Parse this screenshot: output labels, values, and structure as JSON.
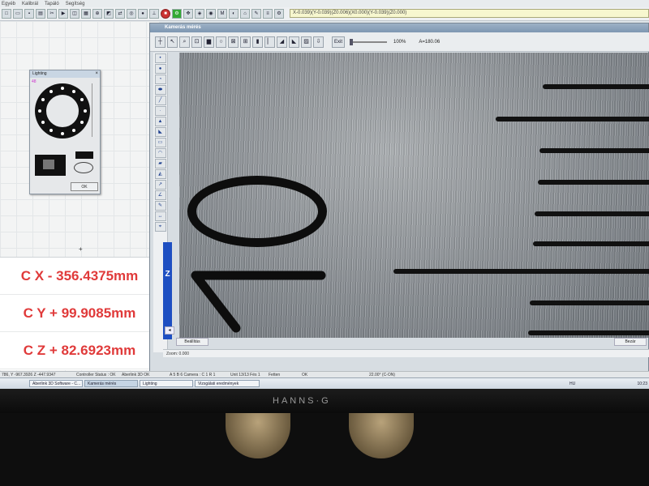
{
  "menu": [
    "Egyéb",
    "Kalibrál",
    "Tapáló",
    "Segítség"
  ],
  "coord_readout": "X-0.039)(Y-0.039)(Z0.006)(X0.000)(Y-0.039)(Z0.000)",
  "lighting": {
    "title": "Lighting",
    "ring_num": "48",
    "ok": "OK",
    "left_num": "1",
    "right_num": "0"
  },
  "dro": {
    "x": "C X - 356.4375mm",
    "y": "C Y + 99.9085mm",
    "z": "C Z + 82.6923mm"
  },
  "camera": {
    "title": "Kamerás mérés",
    "exit": "Exit",
    "zoom_pct": "100%",
    "angle": "A=180.06",
    "beallitas": "Beállítás",
    "bezar": "Bezár",
    "zoom": "Zoom: 0.000",
    "z_label": "Z"
  },
  "status": {
    "pos": "786, Y -967.3926 Z -447.9347",
    "controller": "Controller Status : OK",
    "aberlink": "Aberlink 3D OK",
    "camera": "A 5 B 6 Camera : C 1 R 1",
    "units": "Unit 13/13 Fés 1",
    "state": "Fetten",
    "ok": "OK",
    "temp": "22.00° (C-ON)"
  },
  "taskbar": {
    "items": [
      "Aberlink 3D Software - C...",
      "Kamerás mérés",
      "Lighting",
      "Vizsgálati eredmények"
    ],
    "tray": "HU",
    "clock": "10:23"
  },
  "monitor": {
    "brand": "HANNS·G"
  },
  "colors": {
    "dro_red": "#e03a3a",
    "z_blue": "#1e4fc2"
  }
}
